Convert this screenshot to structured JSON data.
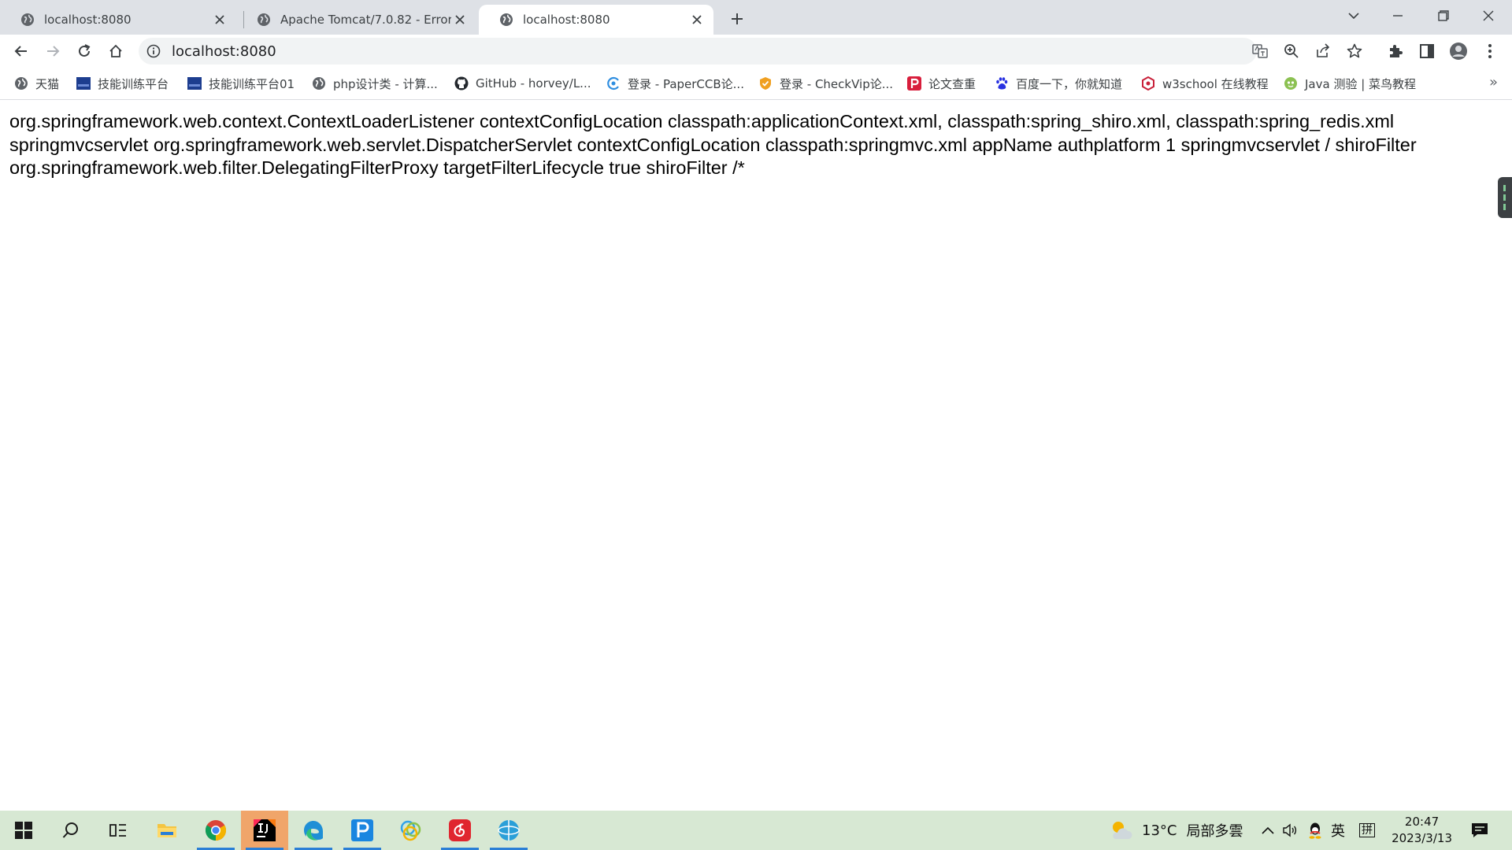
{
  "browser": {
    "tabs": [
      {
        "title": "localhost:8080",
        "active": false
      },
      {
        "title": "Apache Tomcat/7.0.82 - Error report",
        "active": false
      },
      {
        "title": "localhost:8080",
        "active": true
      }
    ],
    "address": "localhost:8080",
    "bookmarks": [
      {
        "label": "天猫",
        "icon": "globe-icon"
      },
      {
        "label": "技能训练平台",
        "icon": "platform-icon"
      },
      {
        "label": "技能训练平台01",
        "icon": "platform-icon"
      },
      {
        "label": "php设计类 - 计算...",
        "icon": "globe-icon"
      },
      {
        "label": "GitHub - horvey/L...",
        "icon": "github-icon"
      },
      {
        "label": "登录 - PaperCCB论...",
        "icon": "paperccb-icon"
      },
      {
        "label": "登录 - CheckVip论...",
        "icon": "checkvip-icon"
      },
      {
        "label": "论文查重",
        "icon": "paperpass-icon"
      },
      {
        "label": "百度一下，你就知道",
        "icon": "baidu-icon"
      },
      {
        "label": "w3school 在线教程",
        "icon": "w3school-icon"
      },
      {
        "label": "Java 测验 | 菜鸟教程",
        "icon": "runoob-icon"
      }
    ],
    "bookmarks_more": "»"
  },
  "page": {
    "lines": [
      "org.springframework.web.context.ContextLoaderListener contextConfigLocation classpath:applicationContext.xml, classpath:spring_shiro.xml, classpath:spring_redis.xml",
      "springmvcservlet org.springframework.web.servlet.DispatcherServlet contextConfigLocation classpath:springmvc.xml appName authplatform 1 springmvcservlet / shiroFilter",
      "org.springframework.web.filter.DelegatingFilterProxy targetFilterLifecycle true shiroFilter /*"
    ]
  },
  "taskbar": {
    "weather": {
      "temp": "13°C",
      "desc": "局部多雲"
    },
    "ime": "英",
    "ime_mode": "拼",
    "time": "20:47",
    "date": "2023/3/13"
  },
  "colors": {
    "tabstrip": "#dee1e6",
    "taskbar": "#d7e8d3",
    "accent": "#2b7fd6"
  }
}
